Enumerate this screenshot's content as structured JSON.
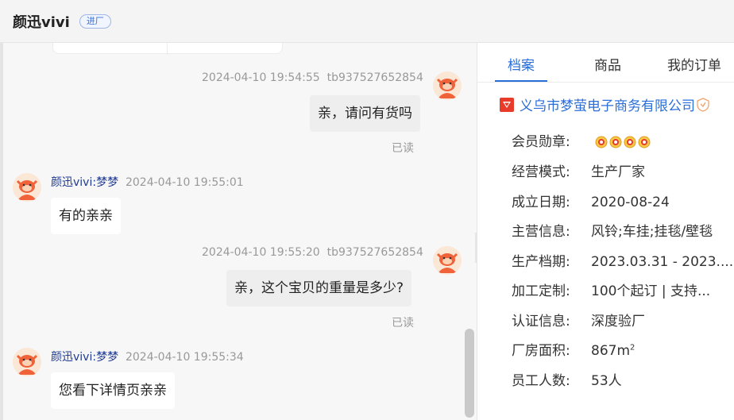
{
  "header": {
    "title": "颜迅vivi",
    "badge": "进厂"
  },
  "chat": {
    "messages": [
      {
        "direction": "out",
        "time": "2024-04-10 19:54:55",
        "sender": "tb937527652854",
        "text": "亲，请问有货吗",
        "read": "已读"
      },
      {
        "direction": "in",
        "sender": "颜迅vivi:梦梦",
        "time": "2024-04-10 19:55:01",
        "text": "有的亲亲"
      },
      {
        "direction": "out",
        "time": "2024-04-10 19:55:20",
        "sender": "tb937527652854",
        "text": "亲，这个宝贝的重量是多少?",
        "read": "已读"
      },
      {
        "direction": "in",
        "sender": "颜迅vivi:梦梦",
        "time": "2024-04-10 19:55:34",
        "text": "您看下详情页亲亲"
      }
    ],
    "collapse_glyph": "»"
  },
  "panel": {
    "tabs": [
      "档案",
      "商品",
      "我的订单"
    ],
    "active_tab": "档案",
    "company": "义乌市梦萤电子商务有限公司",
    "rows": [
      {
        "label": "会员勋章:",
        "value": ""
      },
      {
        "label": "经营模式:",
        "value": "生产厂家"
      },
      {
        "label": "成立日期:",
        "value": "2020-08-24"
      },
      {
        "label": "主营信息:",
        "value": "风铃;车挂;挂毯/壁毯"
      },
      {
        "label": "生产档期:",
        "value": "2023.03.31 - 2023...."
      },
      {
        "label": "加工定制:",
        "value": "100个起订 | 支持..."
      },
      {
        "label": "认证信息:",
        "value": "深度验厂"
      },
      {
        "label": "厂房面积:",
        "value": "867m",
        "sup": "2"
      },
      {
        "label": "员工人数:",
        "value": "53人"
      }
    ]
  },
  "colors": {
    "accent": "#2a6ed8",
    "brand_red": "#e83b2b",
    "avatar_orange": "#f0623a"
  },
  "icons": {
    "company_mark": "alibaba-mark-icon",
    "verified": "shield-badge-icon",
    "medal": "medal-icon",
    "collapse": "double-chevron-right-icon"
  }
}
